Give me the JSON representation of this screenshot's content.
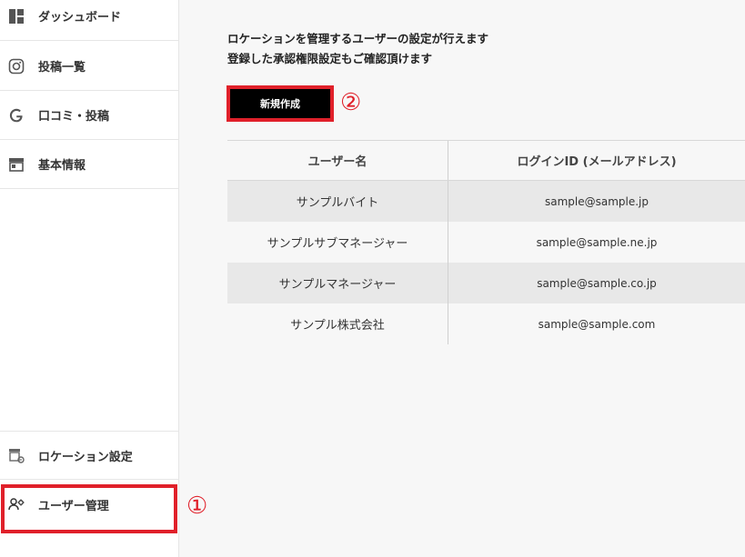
{
  "sidebar": {
    "items": [
      {
        "label": "ダッシュボード",
        "icon": "dashboard-icon"
      },
      {
        "label": "投稿一覧",
        "icon": "instagram-icon"
      },
      {
        "label": "口コミ・投稿",
        "icon": "google-icon"
      },
      {
        "label": "基本情報",
        "icon": "store-icon"
      }
    ],
    "bottom_items": [
      {
        "label": "ロケーション設定",
        "icon": "location-settings-icon"
      },
      {
        "label": "ユーザー管理",
        "icon": "user-settings-icon"
      }
    ]
  },
  "annotations": {
    "marker1": "①",
    "marker2": "②"
  },
  "main": {
    "description_line1": "ロケーションを管理するユーザーの設定が行えます",
    "description_line2": "登録した承認権限設定もご確認頂けます",
    "new_button_label": "新規作成",
    "table": {
      "headers": [
        "ユーザー名",
        "ログインID (メールアドレス)"
      ],
      "rows": [
        {
          "name": "サンプルバイト",
          "email": "sample@sample.jp"
        },
        {
          "name": "サンプルサブマネージャー",
          "email": "sample@sample.ne.jp"
        },
        {
          "name": "サンプルマネージャー",
          "email": "sample@sample.co.jp"
        },
        {
          "name": "サンプル株式会社",
          "email": "sample@sample.com"
        }
      ]
    }
  },
  "colors": {
    "highlight": "#e0202a",
    "button_bg": "#000000",
    "row_alt": "#e8e8e8"
  }
}
